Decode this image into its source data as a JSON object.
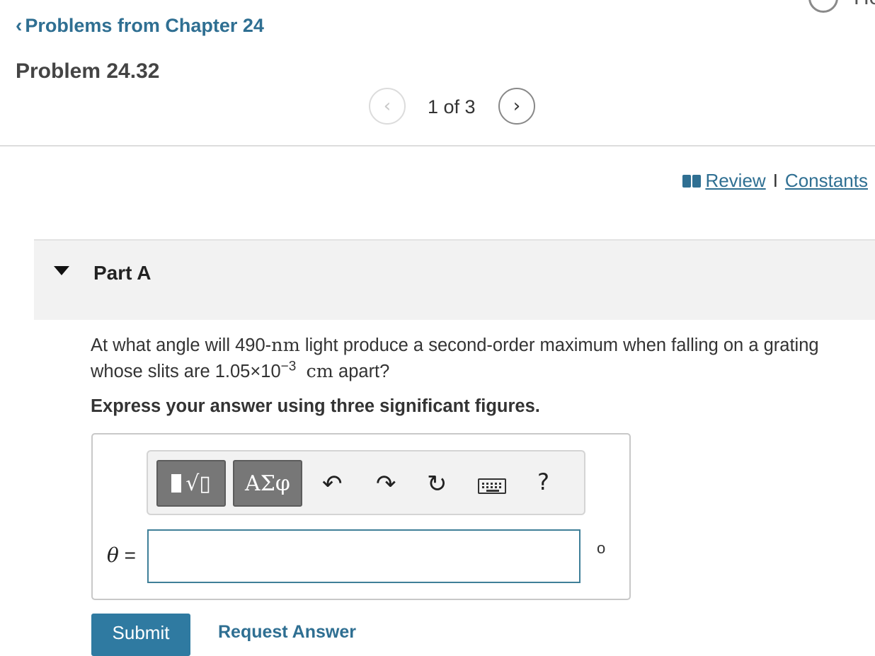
{
  "header": {
    "help_partial": "He",
    "back_link": "Problems from Chapter 24",
    "problem_title": "Problem 24.32"
  },
  "pager": {
    "text": "1 of 3"
  },
  "links": {
    "review": "Review",
    "separator": "I",
    "constants": "Constants"
  },
  "part": {
    "label": "Part A"
  },
  "question": {
    "text_a": "At what angle will 490-",
    "unit_nm": "nm",
    "text_b": " light produce a second-order maximum when falling on a grating whose slits are 1.05×10",
    "exponent": "−3",
    "unit_cm": "cm",
    "text_c": " apart?",
    "instruction": "Express your answer using three significant figures."
  },
  "answer": {
    "greek_button": "ΑΣφ",
    "variable": "θ",
    "equals": " =",
    "input_value": "",
    "unit": "o",
    "help_symbol": "?"
  },
  "actions": {
    "submit": "Submit",
    "request_answer": "Request Answer"
  },
  "icons": {
    "undo": "undo-icon",
    "redo": "redo-icon",
    "reset": "reset-icon",
    "keyboard": "keyboard-icon",
    "book": "book-icon"
  },
  "colors": {
    "link": "#2f6f92",
    "submit_bg": "#2f7aa1",
    "input_border": "#3f7f98"
  }
}
